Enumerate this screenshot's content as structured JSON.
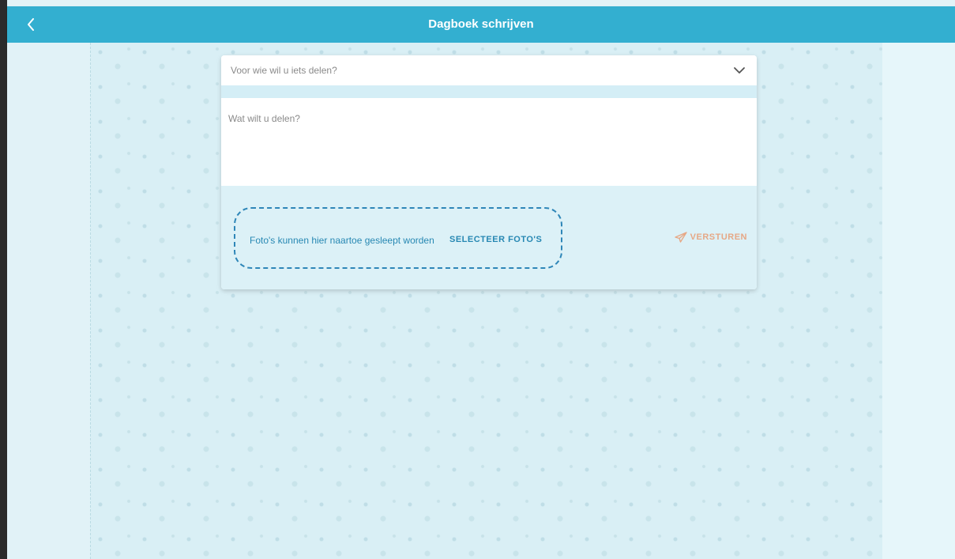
{
  "header": {
    "title": "Dagboek schrijven",
    "back_icon": "chevron-left-icon"
  },
  "form": {
    "recipient_placeholder": "Voor wie wil u iets delen?",
    "message_placeholder": "Wat wilt u delen?",
    "dropzone_text": "Foto's kunnen hier naartoe gesleept worden",
    "select_photos_label": "SELECTEER FOTO'S",
    "send_label": "VERSTUREN"
  },
  "colors": {
    "header_bg": "#33afd0",
    "accent_blue": "#2788b3",
    "send_color": "#e6a886"
  }
}
